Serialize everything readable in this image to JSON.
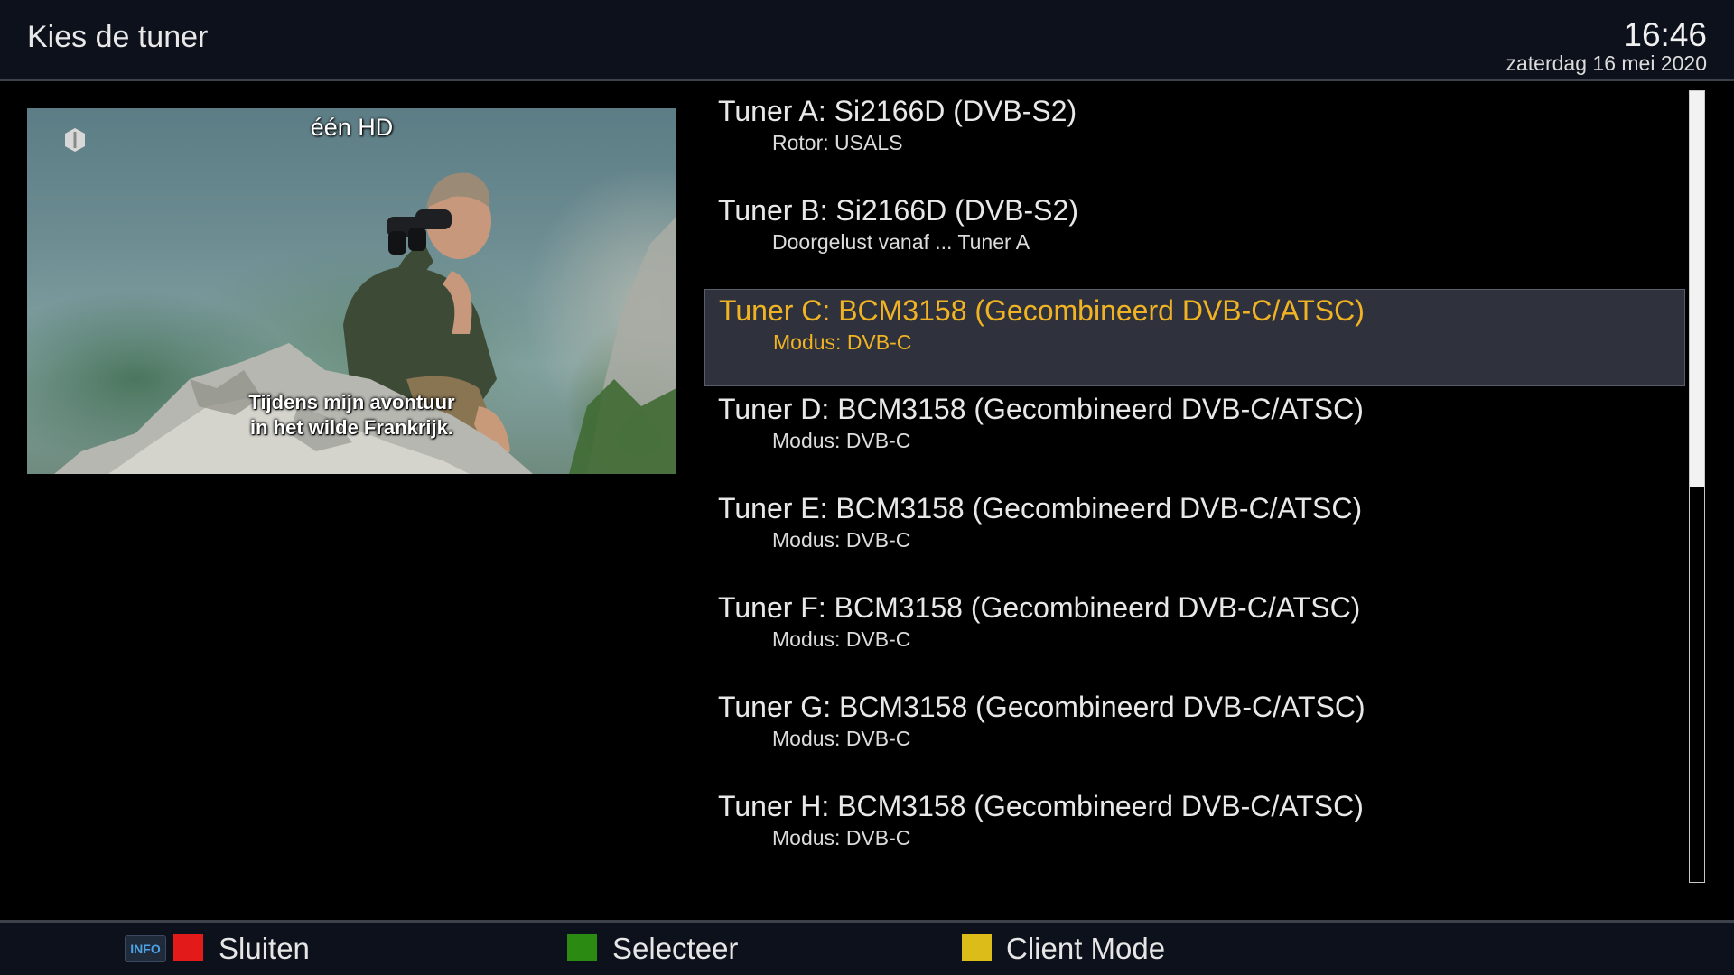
{
  "header": {
    "title": "Kies de tuner",
    "time": "16:46",
    "date": "zaterdag 16 mei 2020"
  },
  "preview": {
    "channel": "één HD",
    "logo_icon": "een-channel-logo-icon",
    "subtitle_line1": "Tijdens mijn avontuur",
    "subtitle_line2": "in het wilde Frankrijk."
  },
  "tuners": [
    {
      "title": "Tuner A: Si2166D (DVB-S2)",
      "detail": "Rotor: USALS"
    },
    {
      "title": "Tuner B: Si2166D (DVB-S2)",
      "detail": "Doorgelust vanaf ... Tuner A"
    },
    {
      "title": "Tuner C: BCM3158 (Gecombineerd DVB-C/ATSC)",
      "detail": "Modus: DVB-C"
    },
    {
      "title": "Tuner D: BCM3158 (Gecombineerd DVB-C/ATSC)",
      "detail": "Modus: DVB-C"
    },
    {
      "title": "Tuner E: BCM3158 (Gecombineerd DVB-C/ATSC)",
      "detail": "Modus: DVB-C"
    },
    {
      "title": "Tuner F: BCM3158 (Gecombineerd DVB-C/ATSC)",
      "detail": "Modus: DVB-C"
    },
    {
      "title": "Tuner G: BCM3158 (Gecombineerd DVB-C/ATSC)",
      "detail": "Modus: DVB-C"
    },
    {
      "title": "Tuner H: BCM3158 (Gecombineerd DVB-C/ATSC)",
      "detail": "Modus: DVB-C"
    }
  ],
  "selected_index": 2,
  "scroll": {
    "position_fraction": 0.0,
    "visible_fraction": 0.5
  },
  "footer": {
    "info_label": "INFO",
    "red_label": "Sluiten",
    "green_label": "Selecteer",
    "yellow_label": "Client Mode"
  },
  "colors": {
    "highlight_text": "#f0b323",
    "red_key": "#e31a1a",
    "green_key": "#2a8a12",
    "yellow_key": "#dcbc19"
  }
}
